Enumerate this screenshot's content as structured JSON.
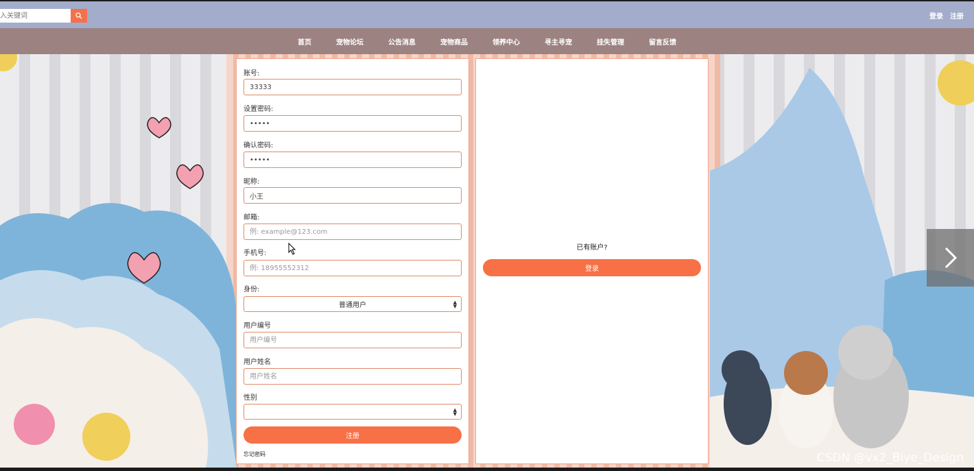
{
  "topbar": {
    "search_placeholder": "入关键词",
    "login_link": "登录",
    "register_link": "注册"
  },
  "nav": {
    "items": [
      "首页",
      "宠物论坛",
      "公告消息",
      "宠物商品",
      "领养中心",
      "寻主寻宠",
      "挂失管理",
      "留言反馈"
    ]
  },
  "register_form": {
    "account_label": "账号:",
    "account_value": "33333",
    "password_label": "设置密码:",
    "password_value": "•••••",
    "confirm_label": "确认密码:",
    "confirm_value": "•••••",
    "nickname_label": "昵称:",
    "nickname_value": "小王",
    "email_label": "邮箱:",
    "email_placeholder": "例: example@123.com",
    "phone_label": "手机号:",
    "phone_placeholder": "例: 18955552312",
    "identity_label": "身份:",
    "identity_value": "普通用户",
    "user_no_label": "用户编号",
    "user_no_placeholder": "用户编号",
    "user_name_label": "用户姓名",
    "user_name_placeholder": "用户姓名",
    "gender_label": "性别",
    "gender_value": "",
    "submit_label": "注册",
    "forgot_label": "忘记密码"
  },
  "login_panel": {
    "prompt": "已有账户?",
    "login_label": "登录"
  },
  "watermark": "CSDN @vx2_Biye_Design",
  "icons": {
    "search": "search-icon",
    "next": "chevron-right-icon"
  },
  "colors": {
    "accent": "#f77046",
    "topbar": "#a3acca",
    "navbar": "#9c8281",
    "input_border": "#e08a68"
  }
}
